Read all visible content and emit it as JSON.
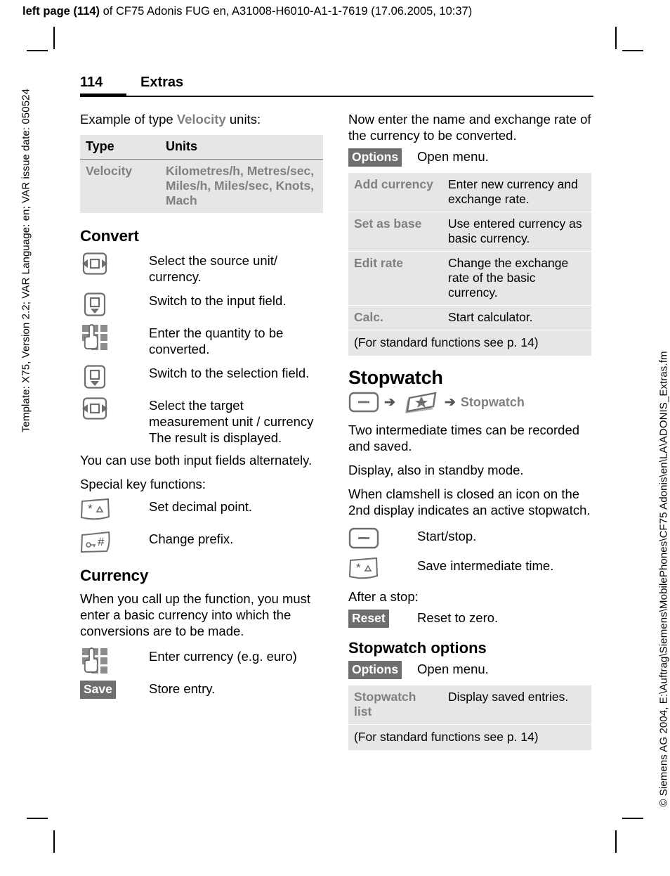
{
  "print_header": {
    "bold_prefix": "left page (114)",
    "rest": " of CF75 Adonis FUG en, A31008-H6010-A1-1-7619 (17.06.2005, 10:37)"
  },
  "side_text": {
    "left": "Template: X75, Version 2.2; VAR Language: en; VAR issue date: 050524",
    "right": "© Siemens AG 2004, E:\\Auftrag\\Siemens\\MobilePhones\\CF75 Adonis\\en\\LA\\ADONIS_Extras.fm"
  },
  "page_header": {
    "number": "114",
    "section": "Extras"
  },
  "left_column": {
    "intro_prefix": "Example of type ",
    "intro_highlight": "Velocity",
    "intro_suffix": " units:",
    "velocity_table": {
      "headers": [
        "Type",
        "Units"
      ],
      "rows": [
        {
          "type": "Velocity",
          "units": "Kilometres/h, Metres/sec, Miles/h, Miles/sec, Knots, Mach"
        }
      ]
    },
    "convert_heading": "Convert",
    "convert_steps": [
      {
        "icon": "nav-key-left-right-icon",
        "text": "Select the source unit/ currency."
      },
      {
        "icon": "nav-key-down-icon",
        "text": "Switch to the input field."
      },
      {
        "icon": "keypad-hand-icon",
        "text": "Enter the quantity to be converted."
      },
      {
        "icon": "nav-key-down-icon",
        "text": "Switch to the selection field."
      },
      {
        "icon": "nav-key-left-right-icon",
        "text": "Select the target measurement unit / currency The result is displayed."
      }
    ],
    "note_alternately": "You can use both input fields alternately.",
    "special_keys_label": "Special key functions:",
    "special_keys": [
      {
        "icon": "star-key-icon",
        "text": "Set decimal point."
      },
      {
        "icon": "hash-key-icon",
        "text": "Change prefix."
      }
    ],
    "currency_heading": "Currency",
    "currency_text": "When you call up the function, you must enter a basic currency into which the conversions are to be made.",
    "currency_steps": [
      {
        "icon": "keypad-hand-icon",
        "text": "Enter currency (e.g. euro)"
      }
    ],
    "save_softkey": "Save",
    "save_text": "Store entry."
  },
  "right_column": {
    "intro": "Now enter the name and exchange rate of the currency to be converted.",
    "options_softkey": "Options",
    "options_text": "Open menu.",
    "currency_options_table": {
      "rows": [
        {
          "key": "Add currency",
          "value": "Enter new currency and exchange rate."
        },
        {
          "key": "Set as base",
          "value": "Use entered currency as basic currency."
        },
        {
          "key": "Edit rate",
          "value": "Change the exchange rate of the basic currency."
        },
        {
          "key": "Calc.",
          "value": "Start calculator."
        }
      ],
      "note": "(For standard functions see p. 14)"
    },
    "stopwatch_heading": "Stopwatch",
    "stopwatch_path": {
      "icon1": "softkey-menu-icon",
      "arrow": "➔",
      "icon2": "extras-star-card-icon",
      "label": "Stopwatch"
    },
    "stopwatch_paragraphs": [
      "Two intermediate times can be recorded and saved.",
      "Display, also in standby mode.",
      "When clamshell is closed an icon on the 2nd display indicates an active stopwatch."
    ],
    "stopwatch_keys": [
      {
        "icon": "softkey-menu-icon",
        "text": "Start/stop."
      },
      {
        "icon": "star-key-icon",
        "text": "Save intermediate time."
      }
    ],
    "after_stop_label": "After a stop:",
    "reset_softkey": "Reset",
    "reset_text": "Reset to zero.",
    "stopwatch_options_heading": "Stopwatch options",
    "sw_options_softkey": "Options",
    "sw_options_text": "Open menu.",
    "stopwatch_options_table": {
      "rows": [
        {
          "key": "Stopwatch list",
          "value": "Display saved entries."
        }
      ],
      "note": "(For standard functions see p. 14)"
    }
  },
  "colors": {
    "table_bg": "#e6e6e6",
    "grey_text": "#808080",
    "softkey_bg": "#6e6e6e",
    "icon_grey": "#6e6e6e"
  }
}
